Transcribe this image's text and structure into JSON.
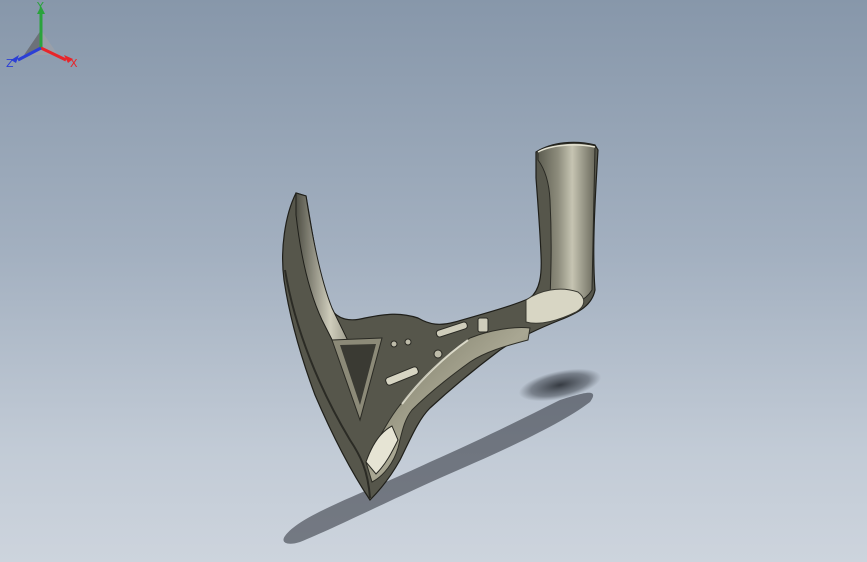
{
  "viewport": {
    "background_top": "#8797aa",
    "background_bottom": "#cdd4dd",
    "model": {
      "name": "bracket-part",
      "body_color": "#6f6f62",
      "highlight_color": "#c9c7b6",
      "edge_color": "#1f1f1a"
    }
  },
  "triad": {
    "x_label": "X",
    "y_label": "Y",
    "z_label": "Z",
    "x_color": "#e8252a",
    "y_color": "#2aa33c",
    "z_color": "#2b3fd6"
  }
}
